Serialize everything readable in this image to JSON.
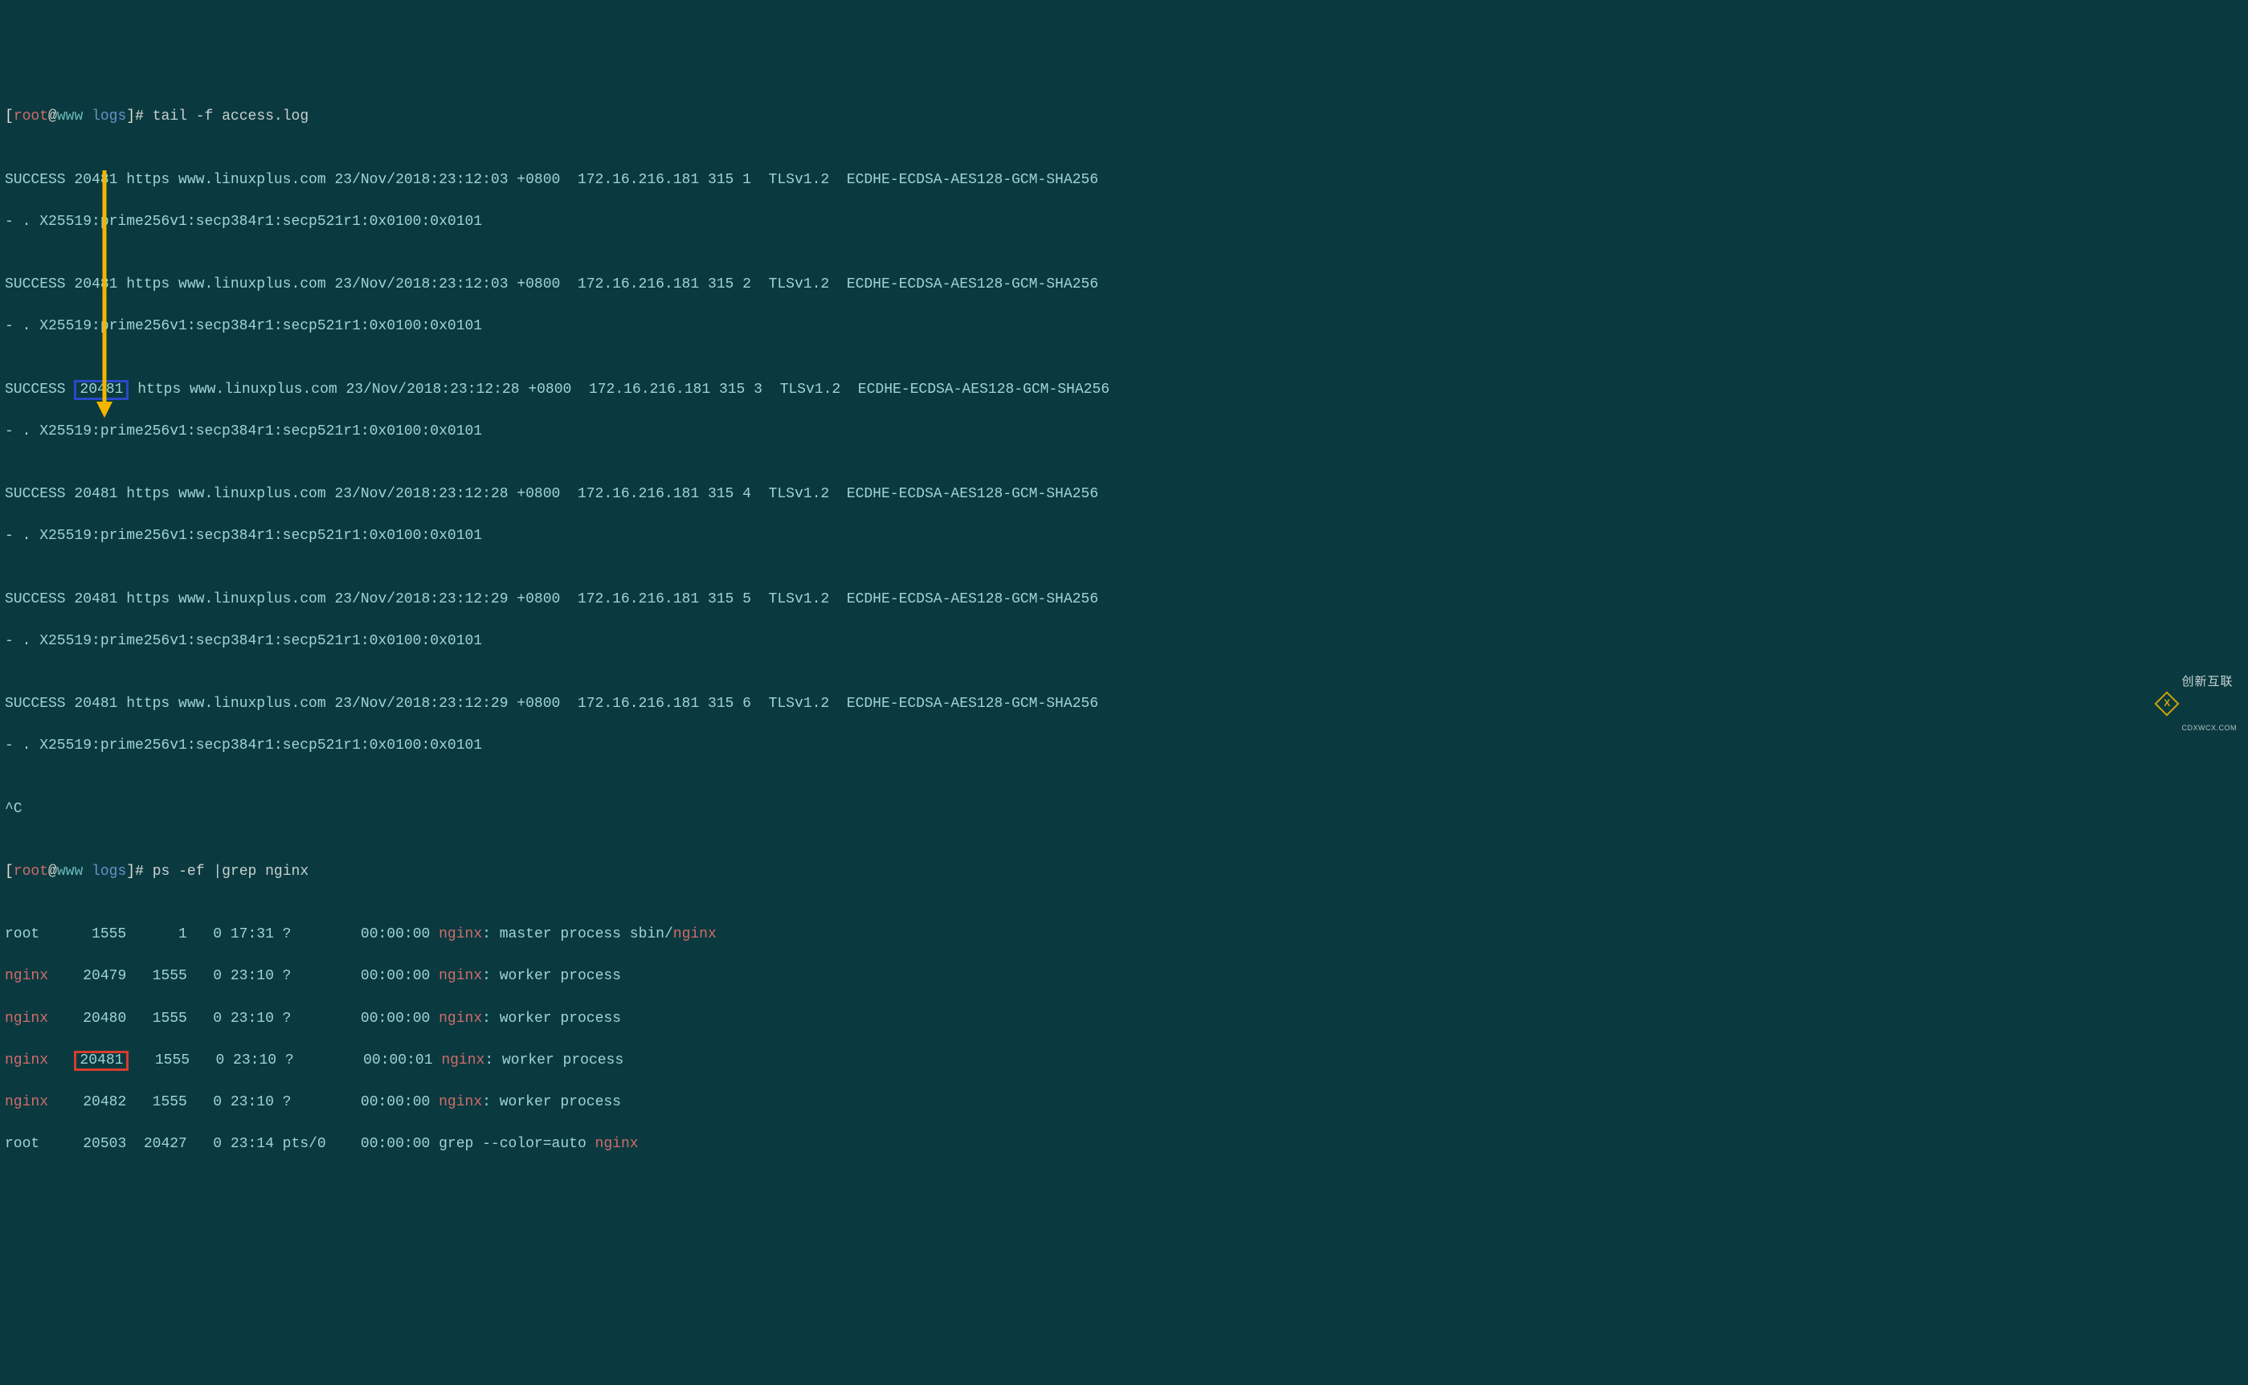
{
  "prompt": {
    "open": "[",
    "user": "root",
    "at": "@",
    "host": "www",
    "space": " ",
    "dir": "logs",
    "close": "]",
    "hash": "# "
  },
  "cmd1": "tail -f access.log",
  "cmd2": "ps -ef |grep nginx",
  "log_entries": [
    {
      "a": "SUCCESS 20481 https www.linuxplus.com 23/Nov/2018:23:12:03 +0800  172.16.216.181 315 1  TLSv1.2  ECDHE-ECDSA-AES128-GCM-SHA256",
      "b": "- . X25519:prime256v1:secp384r1:secp521r1:0x0100:0x0101",
      "highlight_pid": false
    },
    {
      "a": "SUCCESS 20481 https www.linuxplus.com 23/Nov/2018:23:12:03 +0800  172.16.216.181 315 2  TLSv1.2  ECDHE-ECDSA-AES128-GCM-SHA256",
      "b": "- . X25519:prime256v1:secp384r1:secp521r1:0x0100:0x0101",
      "highlight_pid": false
    },
    {
      "a_pre": "SUCCESS ",
      "a_pid": "20481",
      "a_post": " https www.linuxplus.com 23/Nov/2018:23:12:28 +0800  172.16.216.181 315 3  TLSv1.2  ECDHE-ECDSA-AES128-GCM-SHA256",
      "b": "- . X25519:prime256v1:secp384r1:secp521r1:0x0100:0x0101",
      "highlight_pid": true
    },
    {
      "a": "SUCCESS 20481 https www.linuxplus.com 23/Nov/2018:23:12:28 +0800  172.16.216.181 315 4  TLSv1.2  ECDHE-ECDSA-AES128-GCM-SHA256",
      "b": "- . X25519:prime256v1:secp384r1:secp521r1:0x0100:0x0101",
      "highlight_pid": false
    },
    {
      "a": "SUCCESS 20481 https www.linuxplus.com 23/Nov/2018:23:12:29 +0800  172.16.216.181 315 5  TLSv1.2  ECDHE-ECDSA-AES128-GCM-SHA256",
      "b": "- . X25519:prime256v1:secp384r1:secp521r1:0x0100:0x0101",
      "highlight_pid": false
    },
    {
      "a": "SUCCESS 20481 https www.linuxplus.com 23/Nov/2018:23:12:29 +0800  172.16.216.181 315 6  TLSv1.2  ECDHE-ECDSA-AES128-GCM-SHA256",
      "b": "- . X25519:prime256v1:secp384r1:secp521r1:0x0100:0x0101",
      "highlight_pid": false
    }
  ],
  "ctrl_c": "^C",
  "ps_rows": [
    {
      "user": "root",
      "user_hl": false,
      "pid_pre": "      ",
      "pid": "1555",
      "pid_box": false,
      "rest1": "      1   0 17:31 ?        00:00:00 ",
      "hl1": "nginx",
      "rest2": ": master process sbin/",
      "hl2": "nginx",
      "rest3": ""
    },
    {
      "user": "nginx",
      "user_hl": true,
      "pid_pre": "    ",
      "pid": "20479",
      "pid_box": false,
      "rest1": "   1555   0 23:10 ?        00:00:00 ",
      "hl1": "nginx",
      "rest2": ": worker process",
      "hl2": "",
      "rest3": ""
    },
    {
      "user": "nginx",
      "user_hl": true,
      "pid_pre": "    ",
      "pid": "20480",
      "pid_box": false,
      "rest1": "   1555   0 23:10 ?        00:00:00 ",
      "hl1": "nginx",
      "rest2": ": worker process",
      "hl2": "",
      "rest3": ""
    },
    {
      "user": "nginx",
      "user_hl": true,
      "pid_pre": "   ",
      "pid": "20481",
      "pid_box": true,
      "rest1": "   1555   0 23:10 ?        00:00:01 ",
      "hl1": "nginx",
      "rest2": ": worker process",
      "hl2": "",
      "rest3": ""
    },
    {
      "user": "nginx",
      "user_hl": true,
      "pid_pre": "    ",
      "pid": "20482",
      "pid_box": false,
      "rest1": "   1555   0 23:10 ?        00:00:00 ",
      "hl1": "nginx",
      "rest2": ": worker process",
      "hl2": "",
      "rest3": ""
    },
    {
      "user": "root",
      "user_hl": false,
      "pid_pre": "     ",
      "pid": "20503",
      "pid_box": false,
      "rest1": "  20427   0 23:14 pts/0    00:00:00 grep --color=auto ",
      "hl1": "nginx",
      "rest2": "",
      "hl2": "",
      "rest3": ""
    }
  ],
  "watermark": {
    "badge": "X",
    "line1": "创新互联",
    "line2": "CDXWCX.COM"
  }
}
